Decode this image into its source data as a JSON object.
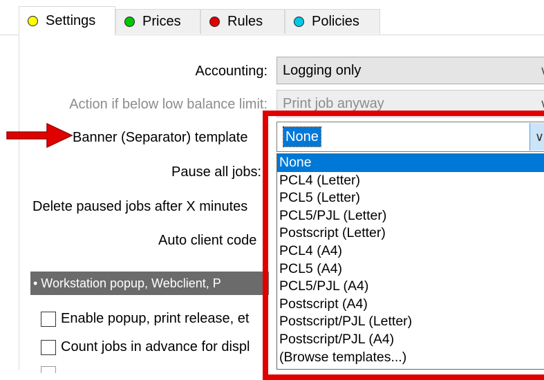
{
  "tabs": [
    {
      "label": "Settings",
      "color": "#ffff00",
      "active": true
    },
    {
      "label": "Prices",
      "color": "#00c800"
    },
    {
      "label": "Rules",
      "color": "#e00000"
    },
    {
      "label": "Policies",
      "color": "#00c8e6"
    }
  ],
  "form": {
    "accounting_label": "Accounting:",
    "accounting_value": "Logging only",
    "low_balance_label": "Action if below low balance limit:",
    "low_balance_value": "Print job anyway",
    "banner_label": "Banner (Separator) template",
    "banner_value": "None",
    "pause_label": "Pause all jobs:",
    "delete_label": "Delete paused jobs after X minutes",
    "auto_client_label": "Auto client code"
  },
  "dropdown": {
    "options": [
      "None",
      "PCL4 (Letter)",
      "PCL5 (Letter)",
      "PCL5/PJL (Letter)",
      "Postscript (Letter)",
      "PCL4 (A4)",
      "PCL5 (A4)",
      "PCL5/PJL (A4)",
      "Postscript (A4)",
      "Postscript/PJL (Letter)",
      "Postscript/PJL (A4)",
      "(Browse templates...)"
    ],
    "highlighted_index": 0
  },
  "section": {
    "title": "• Workstation popup, Webclient, P"
  },
  "checkboxes": [
    {
      "label": "Enable popup, print release, et"
    },
    {
      "label": "Count jobs in advance for displ"
    }
  ],
  "colors": {
    "highlight": "#0078d7",
    "frame": "#e00000",
    "arrow": "#e00000"
  }
}
